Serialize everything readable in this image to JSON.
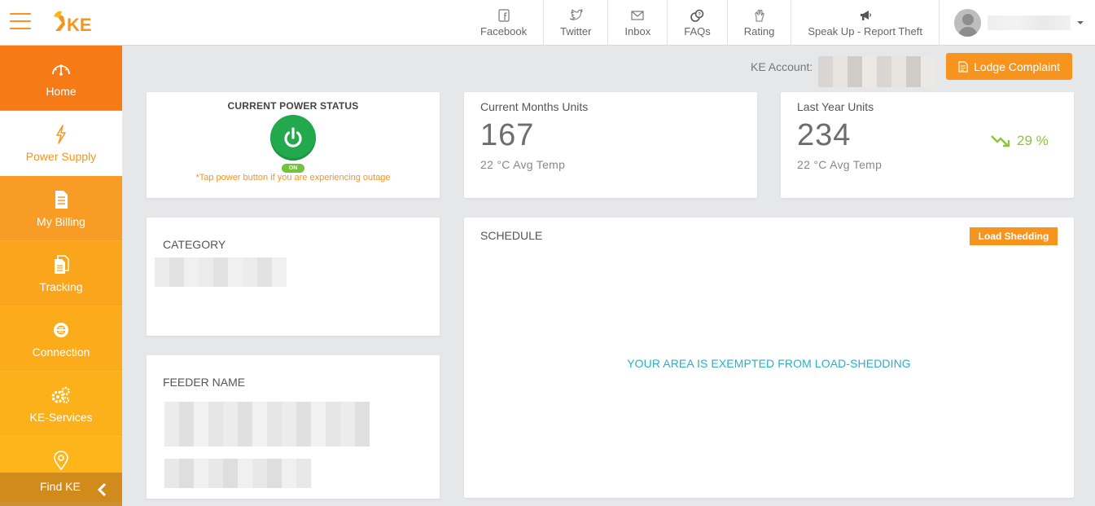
{
  "header": {
    "nav": [
      {
        "label": "Facebook",
        "icon": "facebook-icon"
      },
      {
        "label": "Twitter",
        "icon": "twitter-icon"
      },
      {
        "label": "Inbox",
        "icon": "inbox-icon"
      },
      {
        "label": "FAQs",
        "icon": "faqs-icon"
      },
      {
        "label": "Rating",
        "icon": "rating-icon"
      },
      {
        "label": "Speak Up - Report Theft",
        "icon": "megaphone-icon"
      }
    ]
  },
  "sidebar": {
    "items": [
      {
        "label": "Home",
        "icon": "speedometer-icon"
      },
      {
        "label": "Power Supply",
        "icon": "lightning-icon"
      },
      {
        "label": "My Billing",
        "icon": "document-icon"
      },
      {
        "label": "Tracking",
        "icon": "documents-icon"
      },
      {
        "label": "Connection",
        "icon": "connection-icon"
      },
      {
        "label": "KE-Services",
        "icon": "gears-icon"
      },
      {
        "label": "Find KE",
        "icon": "location-pin-icon"
      }
    ],
    "active": "Power Supply"
  },
  "account": {
    "label": "KE Account:",
    "lodge_label": "Lodge Complaint"
  },
  "power_status": {
    "title": "CURRENT POWER STATUS",
    "state": "ON",
    "hint": "*Tap power button if you are experiencing outage"
  },
  "current_units": {
    "title": "Current Months Units",
    "value": "167",
    "temp": "22 °C Avg Temp"
  },
  "last_year_units": {
    "title": "Last Year Units",
    "value": "234",
    "temp": "22 °C Avg Temp",
    "trend": "29 %"
  },
  "category": {
    "title": "CATEGORY"
  },
  "feeder": {
    "title": "FEEDER NAME"
  },
  "schedule": {
    "title": "SCHEDULE",
    "badge": "Load Shedding",
    "message": "YOUR AREA IS EXEMPTED FROM LOAD-SHEDDING"
  },
  "colors": {
    "brand_orange": "#f7941d",
    "power_green": "#22a94e",
    "trend_green": "#8cc33f",
    "message_teal": "#29b0c8"
  }
}
